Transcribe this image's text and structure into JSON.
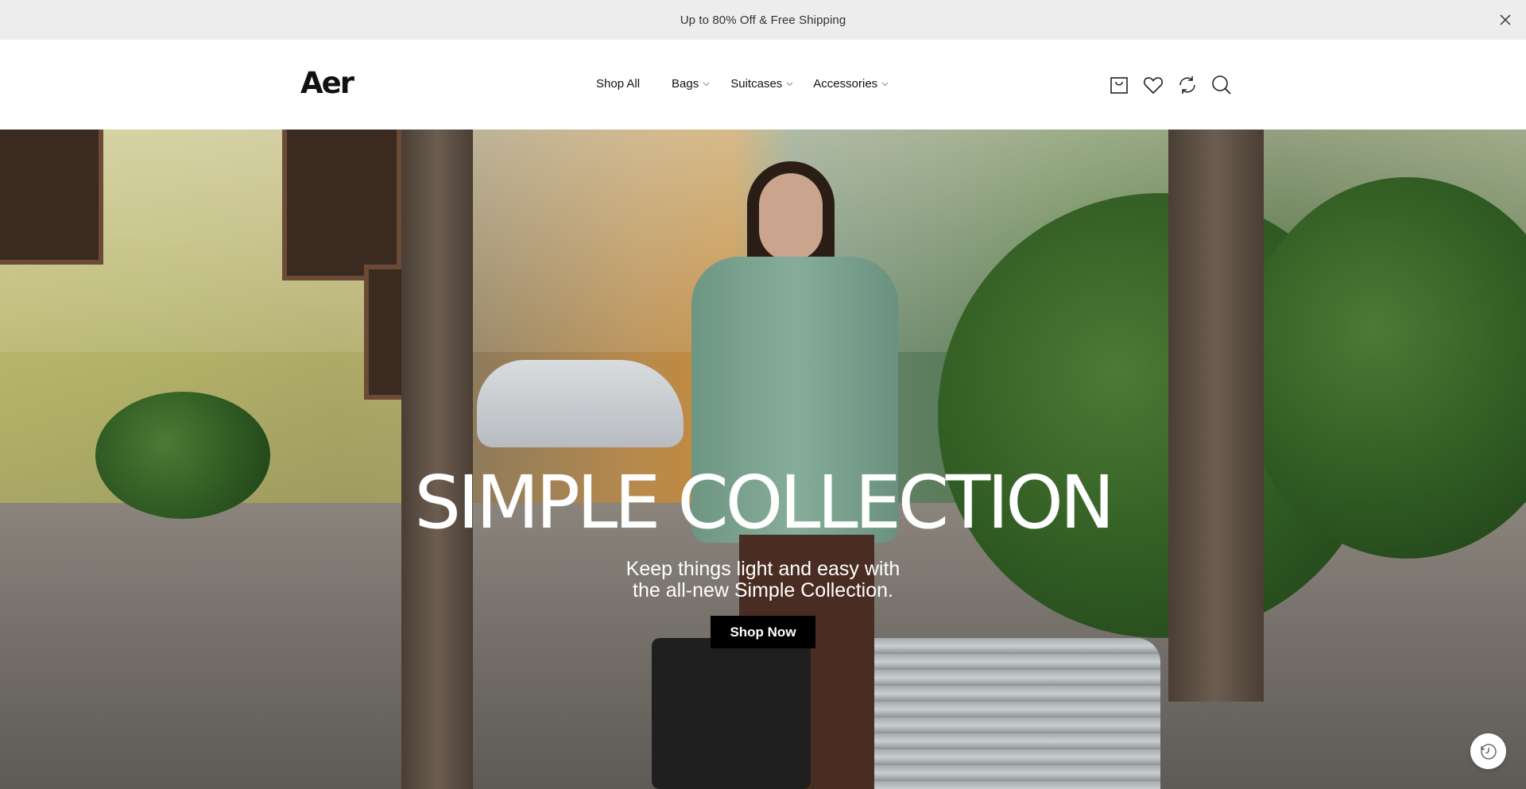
{
  "announcement": {
    "text": "Up to 80% Off & Free Shipping",
    "close_icon": "close-icon"
  },
  "header": {
    "logo": "Aer",
    "nav": [
      {
        "label": "Shop All",
        "has_dropdown": false
      },
      {
        "label": "Bags",
        "has_dropdown": true
      },
      {
        "label": "Suitcases",
        "has_dropdown": true
      },
      {
        "label": "Accessories",
        "has_dropdown": true
      }
    ],
    "icons": [
      "cart-icon",
      "heart-icon",
      "refresh-icon",
      "search-icon"
    ]
  },
  "hero": {
    "title": "SIMPLE COLLECTION",
    "subtitle_line1": "Keep things light and easy with",
    "subtitle_line2": "the all-new Simple Collection.",
    "cta_label": "Shop Now"
  },
  "floating": {
    "history_icon": "history-icon"
  },
  "colors": {
    "announcement_bg": "#ededed",
    "header_bg": "#ffffff",
    "cta_bg": "#000000",
    "cta_text": "#ffffff",
    "hero_text": "#ffffff"
  }
}
